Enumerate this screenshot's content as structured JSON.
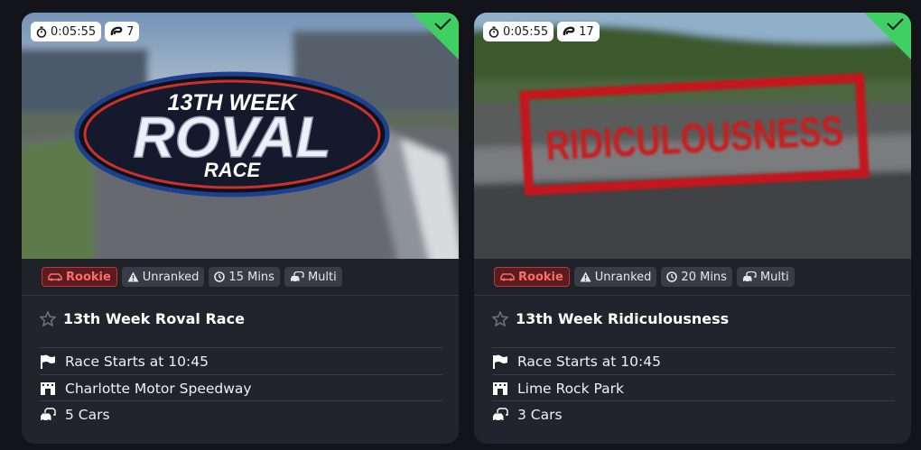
{
  "cards": [
    {
      "timer": "0:05:55",
      "laps": "7",
      "completed": true,
      "hero_logo": {
        "line1": "13TH WEEK",
        "line2": "ROVAL",
        "line3": "RACE"
      },
      "tags": {
        "level": "Rookie",
        "ranking": "Unranked",
        "duration": "15 Mins",
        "mode": "Multi"
      },
      "title": "13th Week Roval Race",
      "start": "Race Starts at 10:45",
      "track": "Charlotte Motor Speedway",
      "cars": "5 Cars"
    },
    {
      "timer": "0:05:55",
      "laps": "17",
      "completed": true,
      "hero_logo": {
        "line1": "RIDICULOUSNESS"
      },
      "tags": {
        "level": "Rookie",
        "ranking": "Unranked",
        "duration": "20 Mins",
        "mode": "Multi"
      },
      "title": "13th Week Ridiculousness",
      "start": "Race Starts at 10:45",
      "track": "Lime Rock Park",
      "cars": "3 Cars"
    }
  ],
  "colors": {
    "page_bg": "#131419",
    "card_bg": "#22242d",
    "check_green": "#3fcf62",
    "rookie_red": "#c0353a"
  }
}
